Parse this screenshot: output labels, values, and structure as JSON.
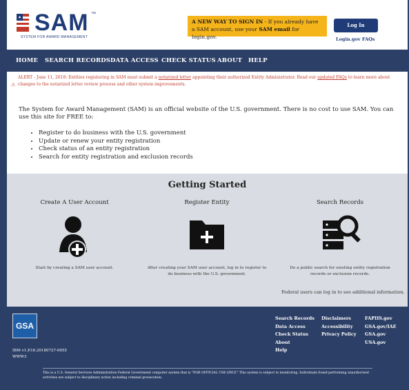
{
  "header": {
    "logo_text": "SAM",
    "logo_tm": "™",
    "logo_subtitle": "SYSTEM FOR AWARD MANAGEMENT",
    "signin_headline": "A NEW WAY TO SIGN IN",
    "signin_text_1": " - If you already have a SAM account, use your ",
    "signin_bold": "SAM email",
    "signin_text_2": " for login.gov.",
    "login_button": "Log In",
    "login_faq": "Login.gov FAQs"
  },
  "nav": {
    "items": [
      "HOME",
      "SEARCH RECORDS",
      "DATA ACCESS",
      "CHECK STATUS",
      "ABOUT",
      "HELP"
    ]
  },
  "alert": {
    "prefix": "ALERT - June 11, 2018: Entities registering in SAM must submit a ",
    "link1": "notarized letter",
    "middle": " appointing their authorized Entity Administrator. Read our ",
    "link2": "updated FAQs",
    "suffix": " to learn more about changes to the notarized letter review process and other system improvements.",
    "icon": "warning-icon"
  },
  "intro": {
    "text": "The System for Award Management (SAM) is an official website of the U.S. government. There is no cost to use SAM. You can use this site for FREE to:",
    "bullets": [
      "Register to do business with the U.S. government",
      "Update or renew your entity registration",
      "Check status of an entity registration",
      "Search for entity registration and exclusion records"
    ]
  },
  "getting_started": {
    "title": "Getting Started",
    "columns": [
      {
        "title": "Create A User Account",
        "icon": "user-add-icon",
        "desc": "Start by creating a SAM user account."
      },
      {
        "title": "Register Entity",
        "icon": "folder-add-icon",
        "desc": "After creating your SAM user account, log in to register to do business with the U.S. government."
      },
      {
        "title": "Search Records",
        "icon": "database-search-icon",
        "desc": "Do a public search for existing entity registration records or exclusion records."
      }
    ],
    "federal_note": "Federal users can log in to see additional information."
  },
  "footer": {
    "gsa": "GSA",
    "ibm_line1": "IBM v1.P.16.20180727-0955",
    "ibm_line2": "WWW3",
    "col1": [
      "Search Records",
      "Data Access",
      "Check Status",
      "About",
      "Help"
    ],
    "col2": [
      "Disclaimers",
      "Accessibility",
      "Privacy Policy"
    ],
    "col3": [
      "FAPIIS.gov",
      "GSA.gov/IAE",
      "GSA.gov",
      "USA.gov"
    ],
    "disclaimer": "This is a U.S. General Services Administration Federal Government computer system that is \"FOR OFFICIAL USE ONLY.\" This system is subject to monitoring. Individuals found performing unauthorized activities are subject to disciplinary action including criminal prosecution."
  },
  "colors": {
    "navy": "#2c3f66",
    "brand_blue": "#1f3c78",
    "signin_yellow": "#f5b41a",
    "alert_red": "#c0392b",
    "section_gray": "#d9dce2"
  }
}
